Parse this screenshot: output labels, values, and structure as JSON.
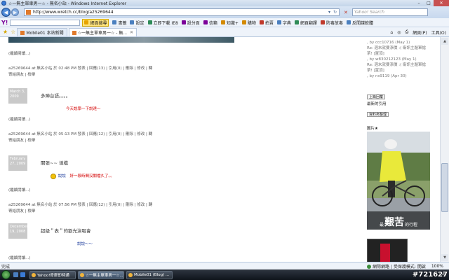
{
  "window": {
    "title": "☆一無主單車男一☆ - 無名小站 - Windows Internet Explorer",
    "min": "–",
    "max": "□",
    "close": "✕"
  },
  "address": {
    "url": "http://www.wretch.cc/blog/a25269644",
    "search_placeholder": "Yahoo! Search"
  },
  "toolbar": {
    "logo": "Y!",
    "buttons": [
      {
        "label": "網頁搜尋",
        "highlight": true,
        "color": "#e6a300"
      },
      {
        "label": "書籤",
        "color": "#4a7fbf"
      },
      {
        "label": "設定",
        "color": "#4a7fbf"
      },
      {
        "label": "立即下載 IE8",
        "color": "#2e8b57"
      },
      {
        "label": "設分頁",
        "color": "#7b0099"
      },
      {
        "label": "信箱",
        "color": "#7b0099"
      },
      {
        "label": "知識+",
        "color": "#d48a00"
      },
      {
        "label": "購物",
        "color": "#d48a00"
      },
      {
        "label": "拍賣",
        "color": "#c0392b"
      },
      {
        "label": "字典",
        "color": "#4a7fbf"
      },
      {
        "label": "網頁翻譯",
        "color": "#2e8b57"
      },
      {
        "label": "防毒放毒",
        "color": "#c0392b"
      },
      {
        "label": "反間諜軟體",
        "color": "#4a7fbf"
      }
    ]
  },
  "tabs": [
    {
      "label": "Mobile01 本站新聞",
      "active": false
    },
    {
      "label": "☆一無主單車男一☆ - 無...",
      "active": true
    }
  ],
  "tabs_right": [
    "網頁(P)",
    "工具(O)"
  ],
  "page": {
    "sidebar_comments": [
      ", by ccc10716 (May 1)",
      "Re: 週末就要漲價 :( 衛訊主題軍搶",
      "茶! [置頂]",
      ", by w830212123 (May 1)",
      "Re: 週末就要漲價 :( 衛訊主題軍搶",
      "茶! [置頂]",
      ", by ns9119 (Apr 30)"
    ],
    "sidebar_btn1": "上篇回覆",
    "sidebar_recent": "最新的引用",
    "sidebar_btn2": "資料夾整理",
    "album_title": "圖片★",
    "photo_caption_small": "最",
    "photo_caption_big": "艱苦",
    "photo_caption_tail": "的行程",
    "posts": [
      {
        "read_more": "(繼續閱讀...)",
        "meta1": "a25269644 at 無名小站 於 02:48 PM 發表 | 回應(13) | 引用(0) | 刪除 | 修改 | 轉",
        "meta2": "寄給朋友 | 檢舉",
        "date": "March 3, 2009",
        "title": "多陣台語。。。。",
        "body": "今天說學一下說達～",
        "body_class": "red"
      },
      {
        "read_more": "(繼續閱讀...)",
        "meta1": "a25269644 at 無名小站 於 05:13 PM 發表 | 回應(12) | 引用(0) | 刪除 | 修改 | 轉",
        "meta2": "寄給朋友 | 檢舉",
        "date": "February 27, 2009",
        "title": "關張~~ 填檔",
        "body": "好一段時間沒關檔久了。。",
        "body_prefix": "說說",
        "body_class": "red"
      },
      {
        "read_more": "(繼續閱讀...)",
        "meta1": "a25269644 at 無名小站 於 07:56 PM 發表 | 回應(12) | 引用(0) | 刪除 | 修改 | 轉",
        "meta2": "寄給朋友 | 檢舉",
        "date": "December 19, 2008",
        "title": "超級＂表＂的劉光演唱會",
        "body": "說說～～",
        "body_class": "blue"
      }
    ],
    "last_read_more": "(繼續閱讀...)"
  },
  "status": {
    "left": "完成",
    "zone": "網際網路 | 受保護模式: 開啟",
    "zoom": "100%"
  },
  "taskbar": {
    "tasks": [
      {
        "label": "Yahoo!奇摩即時通",
        "active": false
      },
      {
        "label": "☆一無主單車男一☆...",
        "active": true
      },
      {
        "label": "Mobile01 (Blog) ...",
        "active": false
      }
    ],
    "tray_text": "上午",
    "watermark": "#721627"
  }
}
